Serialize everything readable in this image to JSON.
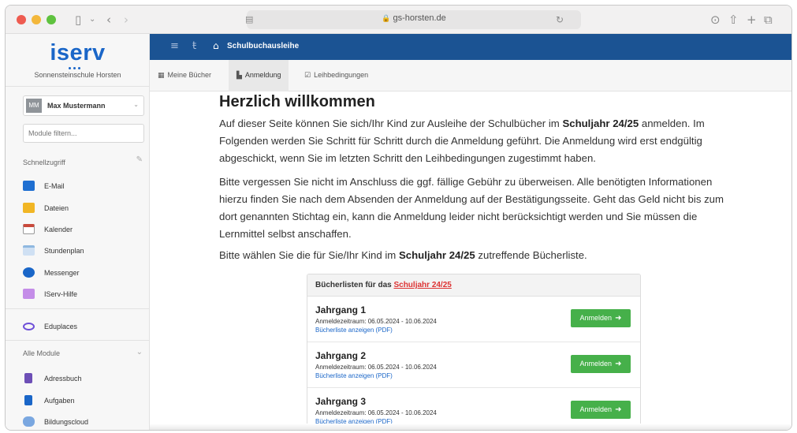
{
  "browser": {
    "url": "gs-horsten.de",
    "lock_icon": "lock-icon",
    "toolbar_icons": [
      "sidebar-icon",
      "chevron-down-icon",
      "back-icon",
      "forward-icon",
      "page-icon",
      "reload-icon",
      "download-icon",
      "share-icon",
      "new-tab-icon",
      "tabs-icon"
    ]
  },
  "sidebar": {
    "logo": "iserv",
    "school": "Sonnensteinschule Horsten",
    "user": {
      "initials": "MM",
      "name": "Max Mustermann"
    },
    "filter_placeholder": "Module filtern...",
    "quick_access_label": "Schnellzugriff",
    "quick_items": [
      {
        "label": "E-Mail",
        "icon": "mail-icon",
        "color": "#1f6fd1"
      },
      {
        "label": "Dateien",
        "icon": "folder-icon",
        "color": "#f1b625"
      },
      {
        "label": "Kalender",
        "icon": "calendar-icon",
        "color": "#c94a3c"
      },
      {
        "label": "Stundenplan",
        "icon": "timetable-icon",
        "color": "#8fb8e0"
      },
      {
        "label": "Messenger",
        "icon": "messenger-icon",
        "color": "#1a66c8"
      },
      {
        "label": "IServ-Hilfe",
        "icon": "help-icon",
        "color": "#c48de8"
      }
    ],
    "eduplaces": {
      "label": "Eduplaces",
      "icon": "eduplaces-icon",
      "color": "#6e4fd8"
    },
    "all_modules_label": "Alle Module",
    "module_items": [
      {
        "label": "Adressbuch",
        "icon": "addressbook-icon",
        "color": "#6d4fb6"
      },
      {
        "label": "Aufgaben",
        "icon": "tasks-icon",
        "color": "#1a66c8"
      },
      {
        "label": "Bildungscloud",
        "icon": "cloud-icon",
        "color": "#7aa7e0"
      }
    ]
  },
  "header": {
    "title": "Schulbuchausleihe",
    "colors": {
      "bar": "#1b5393"
    }
  },
  "tabs": [
    {
      "label": "Meine Bücher",
      "icon": "books-icon",
      "active": false
    },
    {
      "label": "Anmeldung",
      "icon": "document-icon",
      "active": true
    },
    {
      "label": "Leihbedingungen",
      "icon": "checklist-icon",
      "active": false
    }
  ],
  "main": {
    "welcome": "Herzlich willkommen",
    "para1_pre": "Auf dieser Seite können Sie sich/Ihr Kind zur Ausleihe der Schulbücher im ",
    "school_year": "Schuljahr 24/25",
    "para1_post": " anmelden. Im Folgenden werden Sie Schritt für Schritt durch die Anmeldung geführt. Die Anmeldung wird erst endgültig abgeschickt, wenn Sie im letzten Schritt den Leihbedingungen zugestimmt haben.",
    "para2": "Bitte vergessen Sie nicht im Anschluss die ggf. fällige Gebühr zu überweisen. Alle benötigten Informationen hierzu finden Sie nach dem Absenden der Anmeldung auf der Bestätigungsseite. Geht das Geld nicht bis zum dort genannten Stichtag ein, kann die Anmeldung leider nicht berücksichtigt werden und Sie müssen die Lernmittel selbst anschaffen.",
    "para3_pre": "Bitte wählen Sie die für Sie/Ihr Kind im ",
    "para3_post": " zutreffende Bücherliste.",
    "panel_title_pre": "Bücherlisten für das ",
    "panel_title_link": "Schuljahr 24/25",
    "grades": [
      {
        "title": "Jahrgang 1",
        "period": "Anmeldezeitraum: 06.05.2024 - 10.06.2024",
        "link": "Bücherliste anzeigen (PDF)",
        "button": "Anmelden"
      },
      {
        "title": "Jahrgang 2",
        "period": "Anmeldezeitraum: 06.05.2024 - 10.06.2024",
        "link": "Bücherliste anzeigen (PDF)",
        "button": "Anmelden"
      },
      {
        "title": "Jahrgang 3",
        "period": "Anmeldezeitraum: 06.05.2024 - 10.06.2024",
        "link": "Bücherliste anzeigen (PDF)",
        "button": "Anmelden"
      }
    ],
    "colors": {
      "button": "#46b04a",
      "link": "#1a66c8",
      "year_link": "#dd3333"
    }
  }
}
